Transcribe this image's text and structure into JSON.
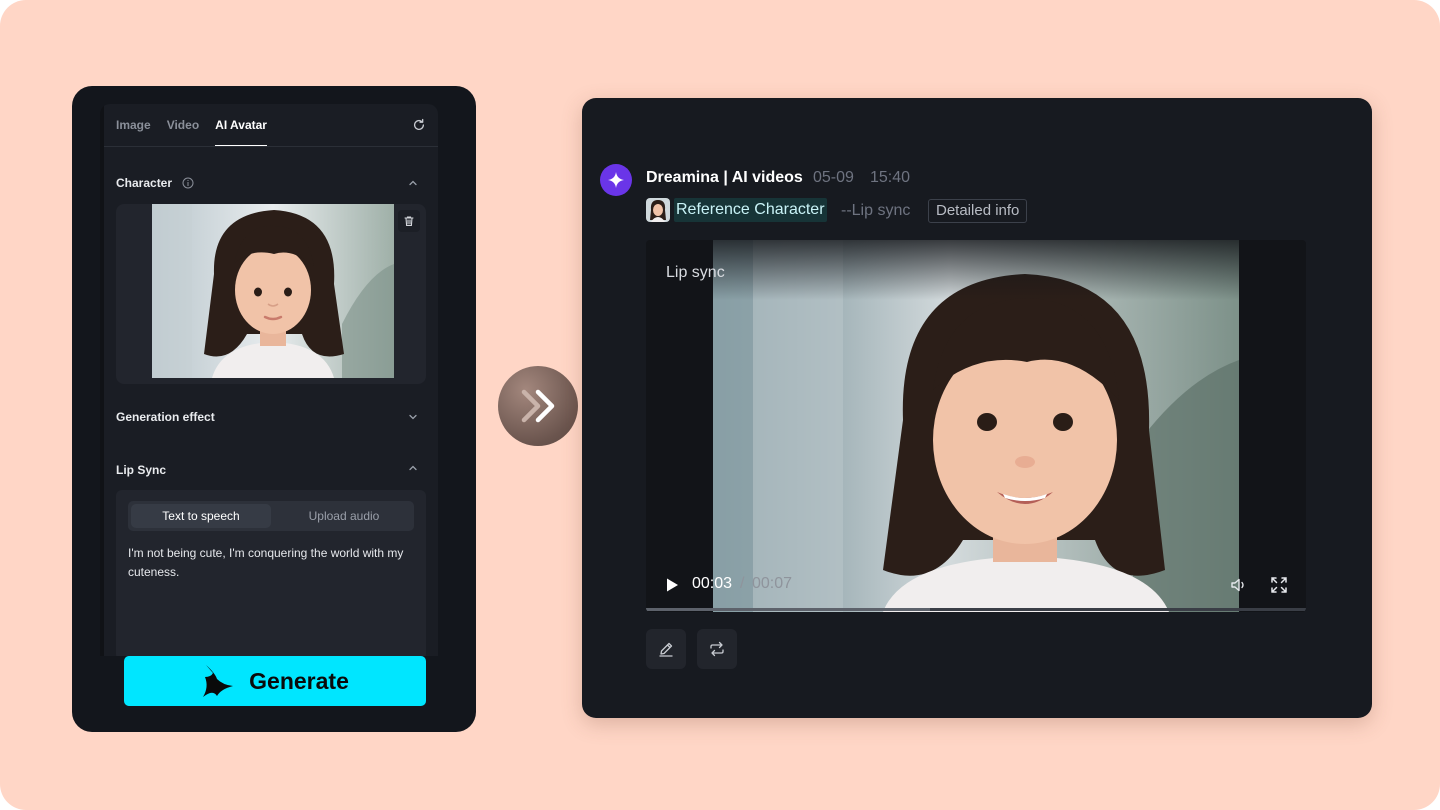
{
  "left_panel": {
    "tabs": [
      "Image",
      "Video",
      "AI Avatar"
    ],
    "active_tab": 2,
    "character": {
      "title": "Character"
    },
    "generation_effect": {
      "title": "Generation effect"
    },
    "lip_sync": {
      "title": "Lip Sync",
      "modes": [
        "Text to speech",
        "Upload audio"
      ],
      "active_mode": 0,
      "text": "I'm not being cute, I'm conquering the world with my cuteness."
    },
    "generate_label": "Generate"
  },
  "right_panel": {
    "app_name": "Dreamina | AI videos",
    "date": "05-09",
    "time": "15:40",
    "reference_label": "Reference Character",
    "mode_label": "--Lip sync",
    "detail_button": "Detailed info",
    "video": {
      "title": "Lip sync",
      "current_time": "00:03",
      "separator": "/",
      "duration": "00:07",
      "progress": 0.43
    }
  },
  "colors": {
    "background": "#ffd6c6",
    "panel": "#13161c",
    "generate": "#00e6ff",
    "accent_purple": "#6a35e8"
  },
  "icons": [
    "refresh-icon",
    "info-icon",
    "chevron-up-icon",
    "chevron-down-icon",
    "trash-icon",
    "capcut-logo-icon",
    "double-chevron-right-icon",
    "sparkle-icon",
    "play-icon",
    "volume-icon",
    "fullscreen-icon",
    "edit-icon",
    "repeat-icon"
  ]
}
